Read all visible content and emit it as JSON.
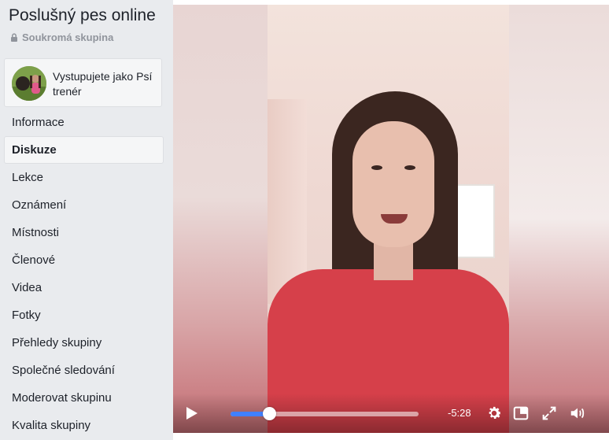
{
  "group": {
    "title": "Poslušný pes online",
    "privacy": "Soukromá skupina"
  },
  "acting_as": {
    "text": "Vystupujete jako Psí trenér"
  },
  "nav": {
    "items": [
      {
        "label": "Informace",
        "active": false
      },
      {
        "label": "Diskuze",
        "active": true
      },
      {
        "label": "Lekce",
        "active": false
      },
      {
        "label": "Oznámení",
        "active": false
      },
      {
        "label": "Místnosti",
        "active": false
      },
      {
        "label": "Členové",
        "active": false
      },
      {
        "label": "Videa",
        "active": false
      },
      {
        "label": "Fotky",
        "active": false
      },
      {
        "label": "Přehledy skupiny",
        "active": false
      },
      {
        "label": "Společné sledování",
        "active": false
      },
      {
        "label": "Moderovat skupinu",
        "active": false
      },
      {
        "label": "Kvalita skupiny",
        "active": false
      }
    ]
  },
  "video": {
    "time_remaining": "-5:28",
    "progress_fraction": 0.206,
    "accent_color": "#4080ff",
    "icons": [
      "play-icon",
      "settings-gear-icon",
      "picture-in-picture-icon",
      "fullscreen-icon",
      "volume-icon"
    ]
  }
}
